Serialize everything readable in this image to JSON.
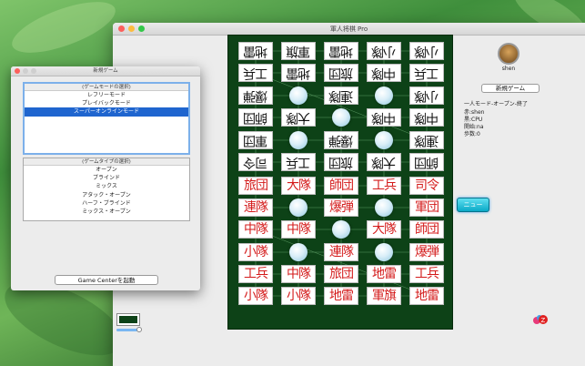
{
  "main_window": {
    "title": "軍人将棋 Pro"
  },
  "board": {
    "cells": [
      {
        "row": 0,
        "col": 0,
        "text": "地雷",
        "color": "black",
        "flip": true
      },
      {
        "row": 0,
        "col": 1,
        "text": "軍旗",
        "color": "black",
        "flip": true
      },
      {
        "row": 0,
        "col": 2,
        "text": "地雷",
        "color": "black",
        "flip": true
      },
      {
        "row": 0,
        "col": 3,
        "text": "小隊",
        "color": "black",
        "flip": true
      },
      {
        "row": 0,
        "col": 4,
        "text": "小隊",
        "color": "black",
        "flip": true
      },
      {
        "row": 1,
        "col": 0,
        "text": "工兵",
        "color": "black",
        "flip": true
      },
      {
        "row": 1,
        "col": 1,
        "text": "地雷",
        "color": "black",
        "flip": true
      },
      {
        "row": 1,
        "col": 2,
        "text": "旅団",
        "color": "black",
        "flip": true
      },
      {
        "row": 1,
        "col": 3,
        "text": "中隊",
        "color": "black",
        "flip": true
      },
      {
        "row": 1,
        "col": 4,
        "text": "工兵",
        "color": "black",
        "flip": true
      },
      {
        "row": 2,
        "col": 0,
        "text": "爆弾",
        "color": "black",
        "flip": true
      },
      {
        "row": 2,
        "col": 2,
        "text": "連隊",
        "color": "black",
        "flip": true
      },
      {
        "row": 2,
        "col": 4,
        "text": "小隊",
        "color": "black",
        "flip": true
      },
      {
        "row": 3,
        "col": 0,
        "text": "師団",
        "color": "black",
        "flip": true
      },
      {
        "row": 3,
        "col": 1,
        "text": "大隊",
        "color": "black",
        "flip": true
      },
      {
        "row": 3,
        "col": 3,
        "text": "中隊",
        "color": "black",
        "flip": true
      },
      {
        "row": 3,
        "col": 4,
        "text": "中隊",
        "color": "black",
        "flip": true
      },
      {
        "row": 4,
        "col": 0,
        "text": "軍団",
        "color": "black",
        "flip": true
      },
      {
        "row": 4,
        "col": 2,
        "text": "爆弾",
        "color": "black",
        "flip": true
      },
      {
        "row": 4,
        "col": 4,
        "text": "連隊",
        "color": "black",
        "flip": true
      },
      {
        "row": 5,
        "col": 0,
        "text": "司令",
        "color": "black",
        "flip": true
      },
      {
        "row": 5,
        "col": 1,
        "text": "工兵",
        "color": "black",
        "flip": true
      },
      {
        "row": 5,
        "col": 2,
        "text": "旅団",
        "color": "black",
        "flip": true
      },
      {
        "row": 5,
        "col": 3,
        "text": "大隊",
        "color": "black",
        "flip": true
      },
      {
        "row": 5,
        "col": 4,
        "text": "師団",
        "color": "black",
        "flip": true
      },
      {
        "row": 6,
        "col": 0,
        "text": "旅団",
        "color": "red",
        "flip": false
      },
      {
        "row": 6,
        "col": 1,
        "text": "大隊",
        "color": "red",
        "flip": false
      },
      {
        "row": 6,
        "col": 2,
        "text": "師団",
        "color": "red",
        "flip": false
      },
      {
        "row": 6,
        "col": 3,
        "text": "工兵",
        "color": "red",
        "flip": false
      },
      {
        "row": 6,
        "col": 4,
        "text": "司令",
        "color": "red",
        "flip": false
      },
      {
        "row": 7,
        "col": 0,
        "text": "連隊",
        "color": "red",
        "flip": false
      },
      {
        "row": 7,
        "col": 2,
        "text": "爆弾",
        "color": "red",
        "flip": false
      },
      {
        "row": 7,
        "col": 4,
        "text": "軍団",
        "color": "red",
        "flip": false
      },
      {
        "row": 8,
        "col": 0,
        "text": "中隊",
        "color": "red",
        "flip": false
      },
      {
        "row": 8,
        "col": 1,
        "text": "中隊",
        "color": "red",
        "flip": false
      },
      {
        "row": 8,
        "col": 3,
        "text": "大隊",
        "color": "red",
        "flip": false
      },
      {
        "row": 8,
        "col": 4,
        "text": "師団",
        "color": "red",
        "flip": false
      },
      {
        "row": 9,
        "col": 0,
        "text": "小隊",
        "color": "red",
        "flip": false
      },
      {
        "row": 9,
        "col": 2,
        "text": "連隊",
        "color": "red",
        "flip": false
      },
      {
        "row": 9,
        "col": 4,
        "text": "爆弾",
        "color": "red",
        "flip": false
      },
      {
        "row": 10,
        "col": 0,
        "text": "工兵",
        "color": "red",
        "flip": false
      },
      {
        "row": 10,
        "col": 1,
        "text": "中隊",
        "color": "red",
        "flip": false
      },
      {
        "row": 10,
        "col": 2,
        "text": "旅団",
        "color": "red",
        "flip": false
      },
      {
        "row": 10,
        "col": 3,
        "text": "地雷",
        "color": "red",
        "flip": false
      },
      {
        "row": 10,
        "col": 4,
        "text": "工兵",
        "color": "red",
        "flip": false
      },
      {
        "row": 11,
        "col": 0,
        "text": "小隊",
        "color": "red",
        "flip": false
      },
      {
        "row": 11,
        "col": 1,
        "text": "小隊",
        "color": "red",
        "flip": false
      },
      {
        "row": 11,
        "col": 2,
        "text": "地雷",
        "color": "red",
        "flip": false
      },
      {
        "row": 11,
        "col": 3,
        "text": "軍旗",
        "color": "red",
        "flip": false
      },
      {
        "row": 11,
        "col": 4,
        "text": "地雷",
        "color": "red",
        "flip": false
      }
    ],
    "camps": [
      {
        "row": 2,
        "col": 1
      },
      {
        "row": 2,
        "col": 3
      },
      {
        "row": 3,
        "col": 2
      },
      {
        "row": 4,
        "col": 1
      },
      {
        "row": 4,
        "col": 3
      },
      {
        "row": 7,
        "col": 1
      },
      {
        "row": 7,
        "col": 3
      },
      {
        "row": 8,
        "col": 2
      },
      {
        "row": 9,
        "col": 1
      },
      {
        "row": 9,
        "col": 3
      }
    ],
    "colors": {
      "black": "#111111",
      "red": "#d41b1b",
      "board": "#0d4217"
    }
  },
  "side_panel": {
    "player_name": "shen",
    "new_game_label": "新規ゲーム",
    "info_lines": [
      "一人モード-オープン-終了",
      "赤:shen",
      "黒:CPU",
      "開始:na",
      "歩数:0"
    ],
    "news_label": "ニュー"
  },
  "dialog": {
    "title": "新規ゲーム",
    "mode_header": "(ゲームモードの選択)",
    "modes": [
      "レフリーモード",
      "プレイバックモード",
      "スーパーオンラインモード"
    ],
    "selected_mode": 2,
    "type_header": "(ゲームタイプの選択)",
    "types": [
      "オープン",
      "ブラインド",
      "ミックス",
      "アタック・オープン",
      "ハーフ・ブラインド",
      "ミックス・オープン"
    ],
    "game_center_label": "Game Centerを起動"
  }
}
